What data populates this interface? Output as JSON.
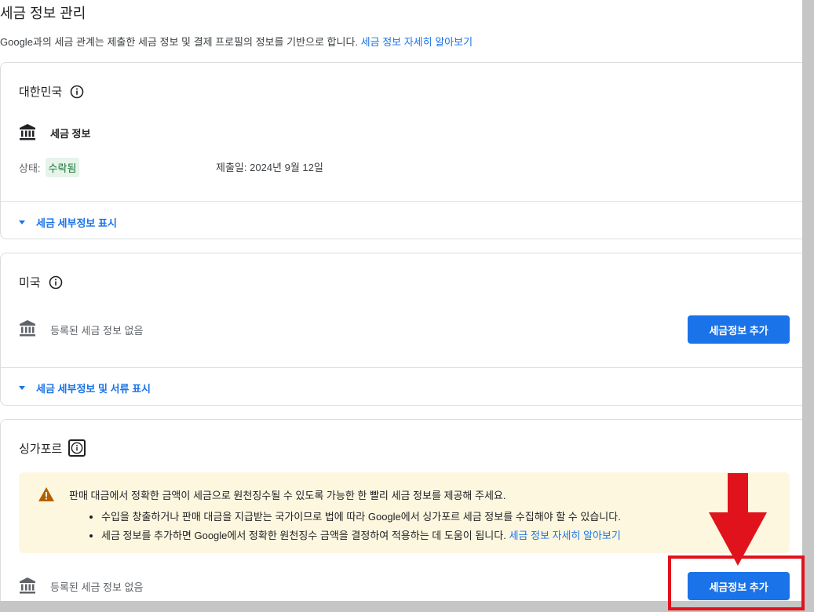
{
  "header": {
    "title": "세금 정보 관리",
    "description": "Google과의 세금 관계는 제출한 세금 정보 및 결제 프로필의 정보를 기반으로 합니다.",
    "learn_more": "세금 정보 자세히 알아보기"
  },
  "korea": {
    "country": "대한민국",
    "section_label": "세금 정보",
    "status_label": "상태:",
    "status_value": "수락됨",
    "submitted": "제출일: 2024년 9월 12일",
    "expand_label": "세금 세부정보 표시"
  },
  "usa": {
    "country": "미국",
    "no_info": "등록된 세금 정보 없음",
    "add_button": "세금정보 추가",
    "expand_label": "세금 세부정보 및 서류 표시"
  },
  "singapore": {
    "country": "싱가포르",
    "warning_text": "판매 대금에서 정확한 금액이 세금으로 원천징수될 수 있도록 가능한 한 빨리 세금 정보를 제공해 주세요.",
    "bullets": [
      "수입을 창출하거나 판매 대금을 지급받는 국가이므로 법에 따라 Google에서 싱가포르 세금 정보를 수집해야 할 수 있습니다.",
      "세금 정보를 추가하면 Google에서 정확한 원천징수 금액을 결정하여 적용하는 데 도움이 됩니다."
    ],
    "learn_more": "세금 정보 자세히 알아보기",
    "no_info": "등록된 세금 정보 없음",
    "add_button": "세금정보 추가"
  },
  "colors": {
    "accent": "#1a73e8",
    "status_bg": "#e6f4ea",
    "status_fg": "#137333",
    "warning_bg": "#fef7e0",
    "warning_icon": "#b06000",
    "annotation_red": "#e0131d"
  },
  "icons": [
    "info-icon",
    "bank-icon",
    "warning-icon",
    "chevron-down-icon",
    "red-arrow-annotation"
  ]
}
